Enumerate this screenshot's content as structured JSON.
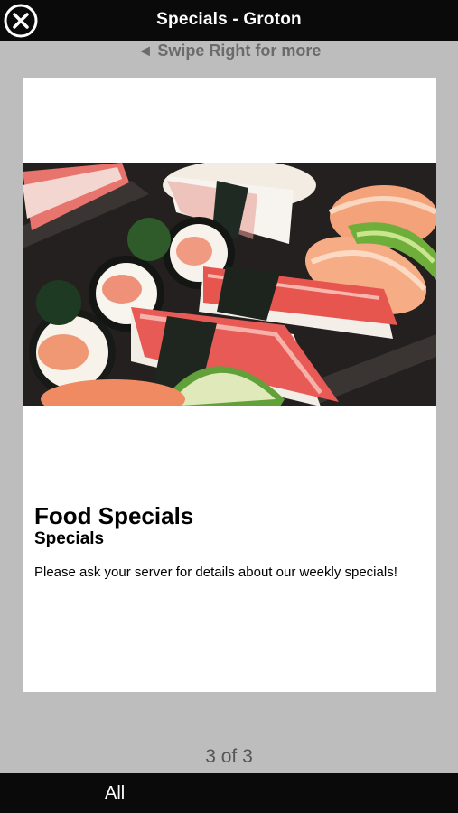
{
  "header": {
    "title": "Specials - Groton",
    "close_icon": "close-circle-icon"
  },
  "swipe_hint": "◄ Swipe Right for more",
  "card": {
    "title": "Food Specials",
    "subtitle": "Specials",
    "description": "Please ask your server for details about our weekly specials!"
  },
  "pager": "3 of 3",
  "footer": {
    "tab_label": "All"
  },
  "colors": {
    "bar": "#0a0a0a",
    "background": "#bdbdbd",
    "card": "#ffffff"
  }
}
